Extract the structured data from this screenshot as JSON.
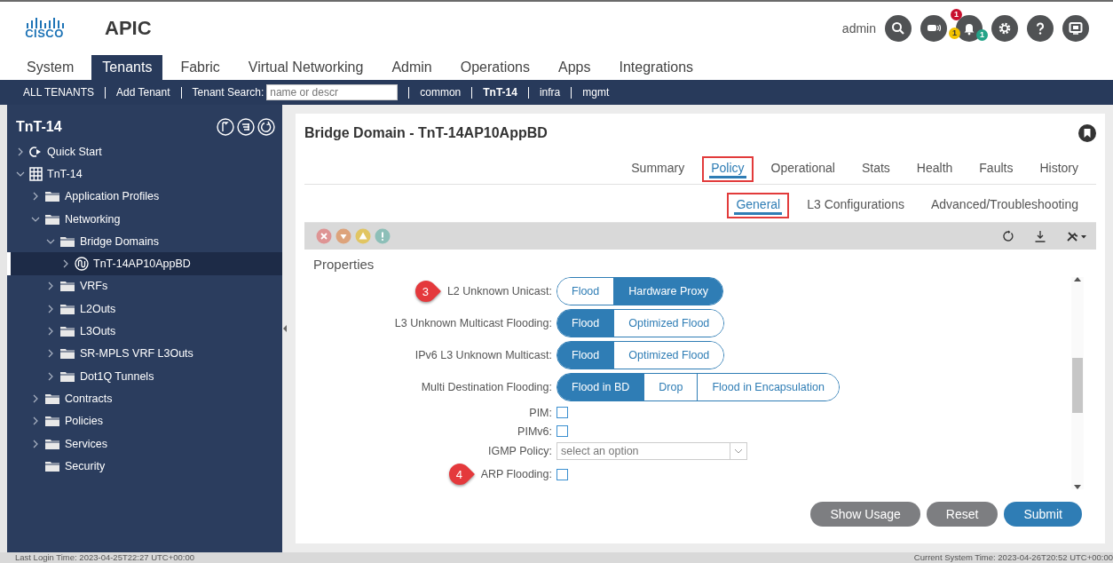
{
  "header": {
    "logo_text": "CISCO",
    "app_name": "APIC",
    "user": "admin",
    "badges": [
      {
        "count": "1",
        "color": "#c8102e"
      },
      {
        "count": "1",
        "color": "#f2c200"
      },
      {
        "count": "1",
        "color": "#24a388"
      }
    ]
  },
  "main_tabs": [
    {
      "label": "System",
      "selected": false
    },
    {
      "label": "Tenants",
      "selected": true
    },
    {
      "label": "Fabric",
      "selected": false
    },
    {
      "label": "Virtual Networking",
      "selected": false
    },
    {
      "label": "Admin",
      "selected": false
    },
    {
      "label": "Operations",
      "selected": false
    },
    {
      "label": "Apps",
      "selected": false
    },
    {
      "label": "Integrations",
      "selected": false
    }
  ],
  "tenant_bar": [
    {
      "kind": "link",
      "label": "ALL TENANTS"
    },
    {
      "kind": "link",
      "label": "Add Tenant"
    },
    {
      "kind": "search",
      "label": "Tenant Search:",
      "placeholder": "name or descr"
    },
    {
      "kind": "tenant",
      "label": "common",
      "selected": false
    },
    {
      "kind": "tenant",
      "label": "TnT-14",
      "selected": true
    },
    {
      "kind": "tenant",
      "label": "infra",
      "selected": false
    },
    {
      "kind": "tenant",
      "label": "mgmt",
      "selected": false
    }
  ],
  "sidebar": {
    "title": "TnT-14",
    "tree": [
      {
        "label": "Quick Start",
        "kind": "quickstart",
        "expandable": true,
        "expanded": false,
        "selected": false
      },
      {
        "label": "TnT-14",
        "kind": "tenant",
        "expandable": true,
        "expanded": true,
        "selected": false,
        "children": [
          {
            "label": "Application Profiles",
            "kind": "folder",
            "expandable": true,
            "expanded": false,
            "selected": false
          },
          {
            "label": "Networking",
            "kind": "folder",
            "expandable": true,
            "expanded": true,
            "selected": false,
            "children": [
              {
                "label": "Bridge Domains",
                "kind": "folder",
                "expandable": true,
                "expanded": true,
                "selected": false,
                "children": [
                  {
                    "label": "TnT-14AP10AppBD",
                    "kind": "bridge-domain",
                    "expandable": true,
                    "expanded": false,
                    "selected": true
                  }
                ]
              },
              {
                "label": "VRFs",
                "kind": "folder",
                "expandable": true,
                "expanded": false,
                "selected": false
              },
              {
                "label": "L2Outs",
                "kind": "folder",
                "expandable": true,
                "expanded": false,
                "selected": false
              },
              {
                "label": "L3Outs",
                "kind": "folder",
                "expandable": true,
                "expanded": false,
                "selected": false
              },
              {
                "label": "SR-MPLS VRF L3Outs",
                "kind": "folder",
                "expandable": true,
                "expanded": false,
                "selected": false
              },
              {
                "label": "Dot1Q Tunnels",
                "kind": "folder",
                "expandable": true,
                "expanded": false,
                "selected": false
              }
            ]
          },
          {
            "label": "Contracts",
            "kind": "folder",
            "expandable": true,
            "expanded": false,
            "selected": false
          },
          {
            "label": "Policies",
            "kind": "folder",
            "expandable": true,
            "expanded": false,
            "selected": false
          },
          {
            "label": "Services",
            "kind": "folder",
            "expandable": true,
            "expanded": false,
            "selected": false
          },
          {
            "label": "Security",
            "kind": "folder",
            "expandable": false,
            "selected": false
          }
        ]
      }
    ]
  },
  "panel": {
    "title": "Bridge Domain - TnT-14AP10AppBD",
    "tabs": [
      {
        "label": "Summary",
        "selected": false,
        "highlighted": false
      },
      {
        "label": "Policy",
        "selected": true,
        "highlighted": true
      },
      {
        "label": "Operational",
        "selected": false,
        "highlighted": false
      },
      {
        "label": "Stats",
        "selected": false,
        "highlighted": false
      },
      {
        "label": "Health",
        "selected": false,
        "highlighted": false
      },
      {
        "label": "Faults",
        "selected": false,
        "highlighted": false
      },
      {
        "label": "History",
        "selected": false,
        "highlighted": false
      }
    ],
    "subtabs": [
      {
        "label": "General",
        "selected": true,
        "highlighted": true
      },
      {
        "label": "L3 Configurations",
        "selected": false,
        "highlighted": false
      },
      {
        "label": "Advanced/Troubleshooting",
        "selected": false,
        "highlighted": false
      }
    ],
    "section": "Properties",
    "fields": [
      {
        "kind": "toggle",
        "label": "L2 Unknown Unicast:",
        "callout": "3",
        "options": [
          {
            "label": "Flood",
            "selected": false
          },
          {
            "label": "Hardware Proxy",
            "selected": true
          }
        ]
      },
      {
        "kind": "toggle",
        "label": "L3 Unknown Multicast Flooding:",
        "options": [
          {
            "label": "Flood",
            "selected": true
          },
          {
            "label": "Optimized Flood",
            "selected": false
          }
        ]
      },
      {
        "kind": "toggle",
        "label": "IPv6 L3 Unknown Multicast:",
        "options": [
          {
            "label": "Flood",
            "selected": true
          },
          {
            "label": "Optimized Flood",
            "selected": false
          }
        ]
      },
      {
        "kind": "toggle",
        "label": "Multi Destination Flooding:",
        "options": [
          {
            "label": "Flood in BD",
            "selected": true
          },
          {
            "label": "Drop",
            "selected": false
          },
          {
            "label": "Flood in Encapsulation",
            "selected": false
          }
        ]
      },
      {
        "kind": "checkbox",
        "label": "PIM:",
        "checked": false
      },
      {
        "kind": "checkbox",
        "label": "PIMv6:",
        "checked": false
      },
      {
        "kind": "select",
        "label": "IGMP Policy:",
        "placeholder": "select an option"
      },
      {
        "kind": "checkbox",
        "label": "ARP Flooding:",
        "checked": false,
        "callout": "4"
      }
    ],
    "buttons": [
      {
        "label": "Show Usage",
        "kind": "secondary"
      },
      {
        "label": "Reset",
        "kind": "secondary"
      },
      {
        "label": "Submit",
        "kind": "primary"
      }
    ]
  },
  "status_bar": {
    "left": "Last Login Time: 2023-04-25T22:27 UTC+00:00",
    "right": "Current System Time: 2023-04-26T20:52 UTC+00:00"
  }
}
